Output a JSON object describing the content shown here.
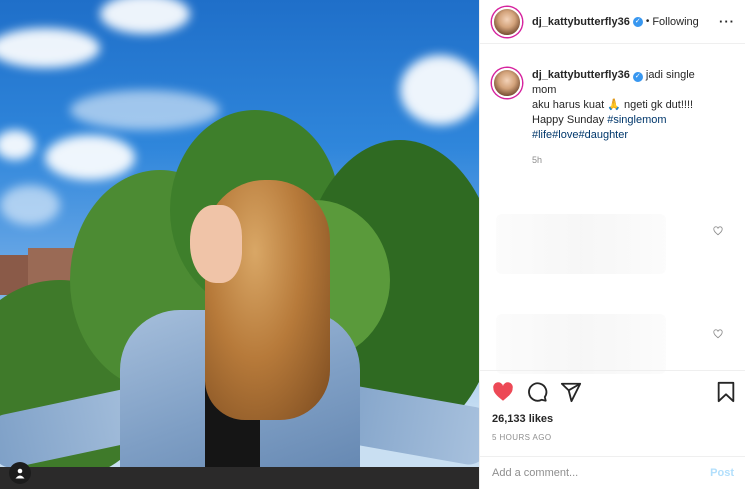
{
  "post": {
    "username": "dj_kattybutterfly36",
    "follow_separator": "•",
    "follow_status": "Following",
    "more_icon": "more-options-icon"
  },
  "caption": {
    "username": "dj_kattybutterfly36",
    "text_line1": "jadi single mom",
    "text_line2_a": "aku harus kuat",
    "text_line2_b": "ngeti gk dut!!!!",
    "text_line3": "Happy Sunday",
    "hashtags_line3": "#singlemom",
    "hashtags_line4": "#life#love#daughter",
    "time_ago": "5h"
  },
  "engagement": {
    "likes": "26,133 likes",
    "posted": "5 HOURS AGO",
    "liked": true,
    "colors": {
      "liked_heart": "#ed4956",
      "hashtag": "#00376b",
      "post_disabled": "#b2dffc"
    }
  },
  "comment_box": {
    "placeholder": "Add a comment...",
    "post_label": "Post"
  }
}
